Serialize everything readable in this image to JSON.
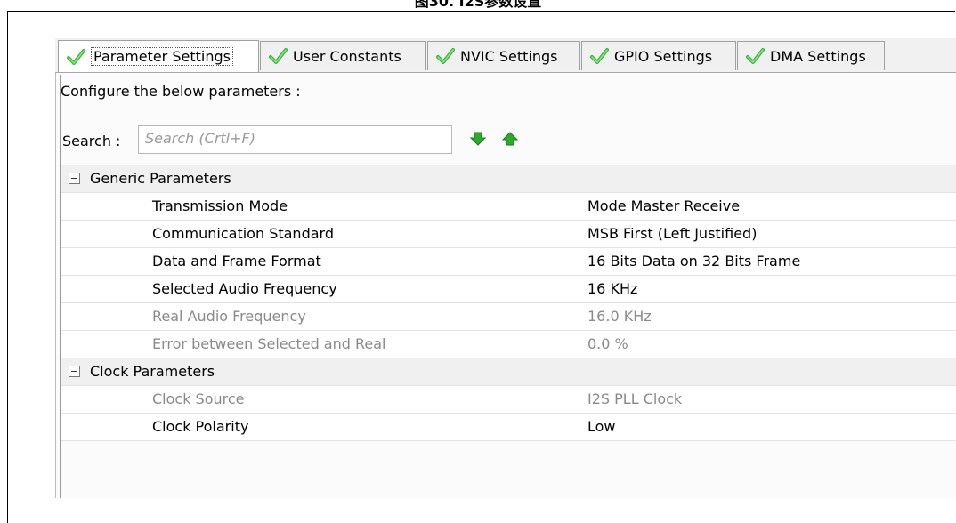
{
  "caption": "图30. I2S参数设置",
  "tabs": [
    {
      "label": "Parameter Settings",
      "icon": "checkmark-icon",
      "active": true
    },
    {
      "label": "User Constants",
      "icon": "checkmark-icon",
      "active": false
    },
    {
      "label": "NVIC Settings",
      "icon": "checkmark-icon",
      "active": false
    },
    {
      "label": "GPIO Settings",
      "icon": "checkmark-icon",
      "active": false
    },
    {
      "label": "DMA Settings",
      "icon": "checkmark-icon",
      "active": false
    }
  ],
  "configure_text": "Configure the below parameters :",
  "search": {
    "label": "Search :",
    "placeholder": "Search (Crtl+F)",
    "down_icon": "arrow-down-icon",
    "up_icon": "arrow-up-icon"
  },
  "groups": [
    {
      "title": "Generic Parameters",
      "rows": [
        {
          "name": "Transmission Mode",
          "value": "Mode Master Receive",
          "enabled": true
        },
        {
          "name": "Communication Standard",
          "value": "MSB First (Left Justified)",
          "enabled": true
        },
        {
          "name": "Data and Frame Format",
          "value": "16 Bits Data on 32 Bits Frame",
          "enabled": true
        },
        {
          "name": "Selected Audio Frequency",
          "value": "16 KHz",
          "enabled": true
        },
        {
          "name": "Real Audio Frequency",
          "value": "16.0 KHz",
          "enabled": false
        },
        {
          "name": "Error between Selected and Real",
          "value": "0.0 %",
          "enabled": false
        }
      ]
    },
    {
      "title": "Clock Parameters",
      "rows": [
        {
          "name": "Clock Source",
          "value": "I2S PLL Clock",
          "enabled": false
        },
        {
          "name": "Clock Polarity",
          "value": "Low",
          "enabled": true
        }
      ]
    }
  ],
  "colors": {
    "check_green": "#3db33d",
    "arrow_green": "#2fa82f",
    "disabled_text": "#8a8a8a",
    "group_bg": "#f0f0f0"
  }
}
